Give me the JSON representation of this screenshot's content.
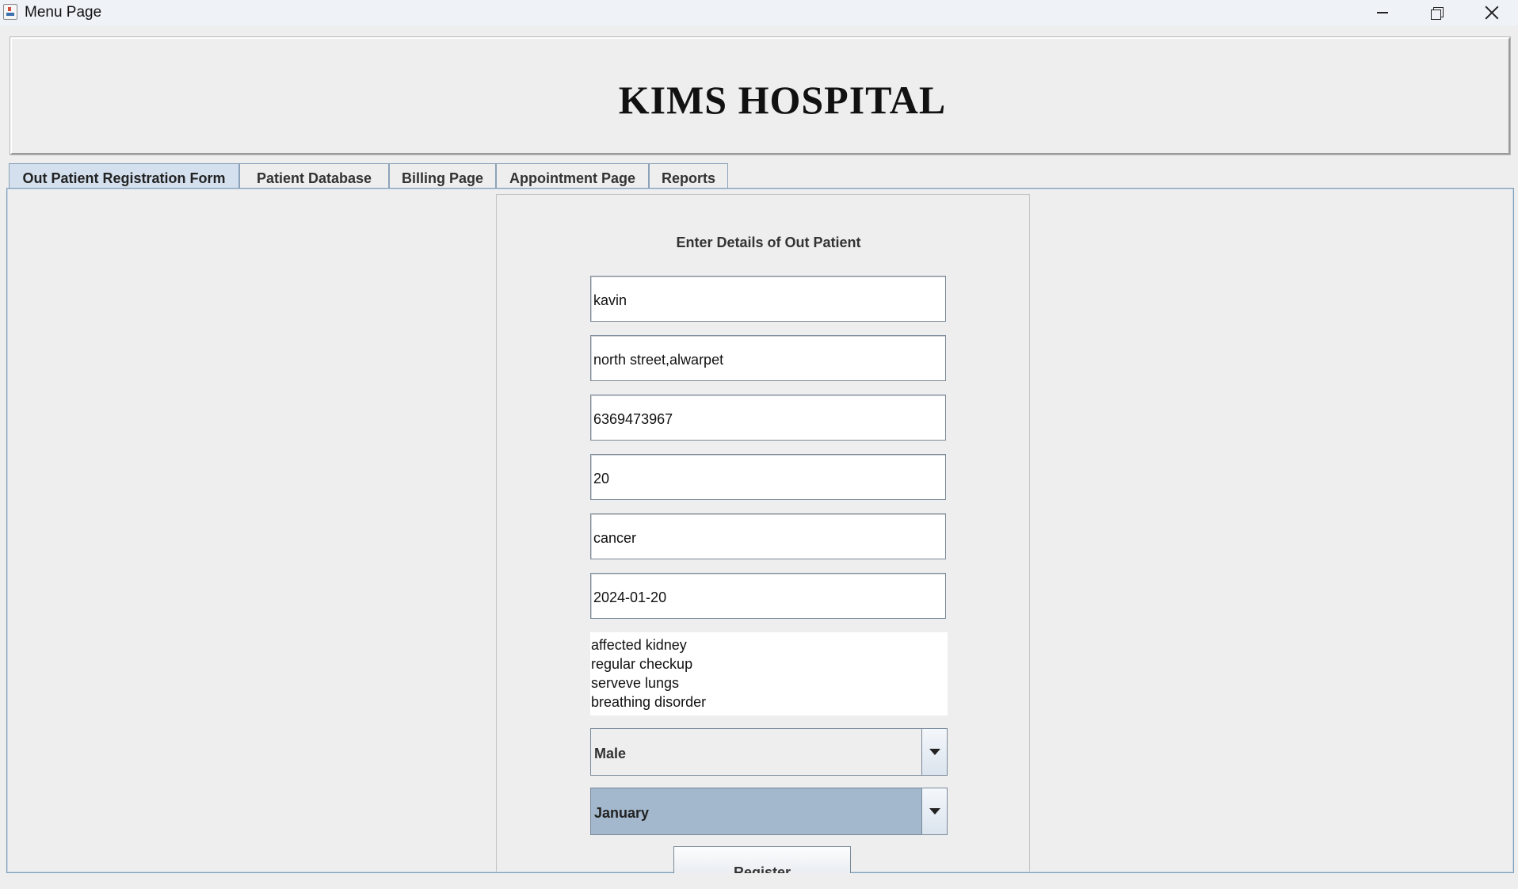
{
  "window": {
    "title": "Menu Page"
  },
  "header": {
    "hospital_name": "KIMS HOSPITAL"
  },
  "tabs": [
    {
      "label": "Out Patient Registration Form",
      "active": true
    },
    {
      "label": "Patient Database",
      "active": false
    },
    {
      "label": "Billing Page",
      "active": false
    },
    {
      "label": "Appointment Page",
      "active": false
    },
    {
      "label": "Reports",
      "active": false
    }
  ],
  "form": {
    "heading": "Enter Details of Out Patient",
    "fields": {
      "name": "kavin",
      "address": "north street,alwarpet",
      "phone": "6369473967",
      "age": "20",
      "disease": "cancer",
      "date": "2024-01-20"
    },
    "list_items": [
      "affected kidney",
      "regular checkup",
      "serveve lungs",
      "breathing disorder"
    ],
    "gender_select": "Male",
    "month_select": "January",
    "register_label": "Register"
  },
  "colors": {
    "titlebar": "#eff3f8",
    "active_tab": "#d4e0ee",
    "selected_combo": "#a3b8cc",
    "background": "#eeeeee"
  }
}
